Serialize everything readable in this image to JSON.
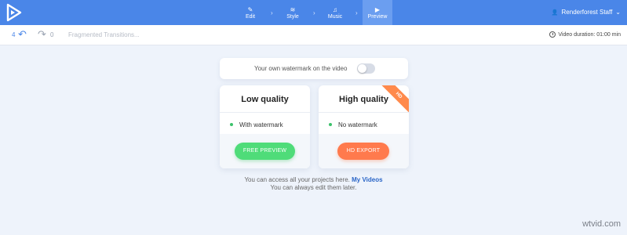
{
  "topbar": {
    "steps": [
      {
        "label": "Edit",
        "icon": "✎"
      },
      {
        "label": "Style",
        "icon": "≋"
      },
      {
        "label": "Music",
        "icon": "♫"
      },
      {
        "label": "Preview",
        "icon": "▶"
      }
    ],
    "active_step": "Preview",
    "user_name": "Renderforest Staff",
    "user_icon": "👤",
    "dropdown_icon": "⌄",
    "colors": {
      "bar": "#4a86e8",
      "active": "#6b9ef0"
    }
  },
  "toolbar": {
    "undo_count": "4",
    "redo_count": "0",
    "project_title": "Fragmented Transitions...",
    "duration_label": "Video duration: 01:00 min"
  },
  "watermark_option": {
    "label": "Your own watermark on the video",
    "enabled": false
  },
  "quality_cards": {
    "low": {
      "title": "Low quality",
      "feature": "With watermark",
      "button": "FREE PREVIEW",
      "button_color": "#4fdc79"
    },
    "high": {
      "title": "High quality",
      "feature": "No watermark",
      "button": "HD EXPORT",
      "button_color": "#ff7a4d",
      "badge": "HD"
    }
  },
  "footer": {
    "line1_prefix": "You can access all your projects here.",
    "line1_link": "My Videos",
    "line2": "You can always edit them later."
  },
  "site_watermark": "wtvid.com"
}
